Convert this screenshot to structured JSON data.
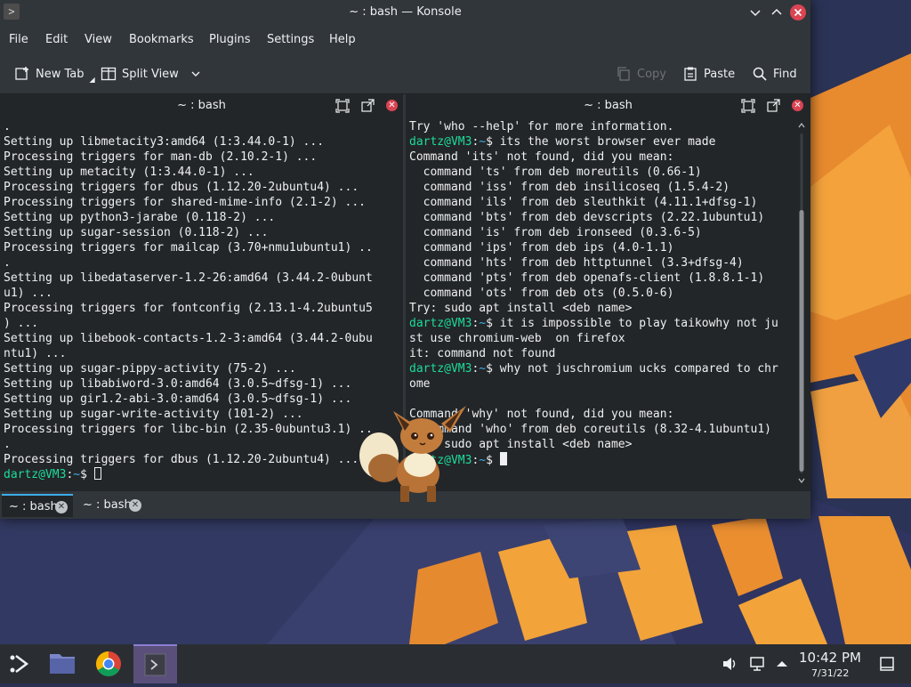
{
  "window": {
    "title": "~ : bash — Konsole",
    "app_icon": "terminal-icon"
  },
  "menu": [
    "File",
    "Edit",
    "View",
    "Bookmarks",
    "Plugins",
    "Settings",
    "Help"
  ],
  "toolbar": {
    "new_tab": "New Tab",
    "split_view": "Split View",
    "copy": "Copy",
    "paste": "Paste",
    "find": "Find"
  },
  "panes": {
    "left": {
      "title": "~ : bash",
      "lines": [
        ".",
        "Setting up libmetacity3:amd64 (1:3.44.0-1) ...",
        "Processing triggers for man-db (2.10.2-1) ...",
        "Setting up metacity (1:3.44.0-1) ...",
        "Processing triggers for dbus (1.12.20-2ubuntu4) ...",
        "Processing triggers for shared-mime-info (2.1-2) ...",
        "Setting up python3-jarabe (0.118-2) ...",
        "Setting up sugar-session (0.118-2) ...",
        "Processing triggers for mailcap (3.70+nmu1ubuntu1) ..",
        ".",
        "Setting up libedataserver-1.2-26:amd64 (3.44.2-0ubunt",
        "u1) ...",
        "Processing triggers for fontconfig (2.13.1-4.2ubuntu5",
        ") ...",
        "Setting up libebook-contacts-1.2-3:amd64 (3.44.2-0ubu",
        "ntu1) ...",
        "Setting up sugar-pippy-activity (75-2) ...",
        "Setting up libabiword-3.0:amd64 (3.0.5~dfsg-1) ...",
        "Setting up gir1.2-abi-3.0:amd64 (3.0.5~dfsg-1) ...",
        "Setting up sugar-write-activity (101-2) ...",
        "Processing triggers for libc-bin (2.35-0ubuntu3.1) ..",
        ".",
        "Processing triggers for dbus (1.12.20-2ubuntu4) ..."
      ],
      "prompt_user": "dartz@VM3",
      "prompt_path": "~",
      "prompt_symbol": "$ "
    },
    "right": {
      "title": "~ : bash",
      "lines": [
        {
          "t": "Try 'who --help' for more information."
        },
        {
          "p": true,
          "t": "its the worst browser ever made"
        },
        {
          "t": "Command 'its' not found, did you mean:"
        },
        {
          "t": "  command 'ts' from deb moreutils (0.66-1)"
        },
        {
          "t": "  command 'iss' from deb insilicoseq (1.5.4-2)"
        },
        {
          "t": "  command 'ils' from deb sleuthkit (4.11.1+dfsg-1)"
        },
        {
          "t": "  command 'bts' from deb devscripts (2.22.1ubuntu1)"
        },
        {
          "t": "  command 'is' from deb ironseed (0.3.6-5)"
        },
        {
          "t": "  command 'ips' from deb ips (4.0-1.1)"
        },
        {
          "t": "  command 'hts' from deb httptunnel (3.3+dfsg-4)"
        },
        {
          "t": "  command 'pts' from deb openafs-client (1.8.8.1-1)"
        },
        {
          "t": "  command 'ots' from deb ots (0.5.0-6)"
        },
        {
          "t": "Try: sudo apt install <deb name>"
        },
        {
          "p": true,
          "t": "it is impossible to play taikowhy not ju"
        },
        {
          "t": "st use chromium-web  on firefox"
        },
        {
          "t": "it: command not found"
        },
        {
          "p": true,
          "t": "why not juschromium ucks compared to chr"
        },
        {
          "t": "ome"
        },
        {
          "t": ""
        },
        {
          "t": "Command 'why' not found, did you mean:"
        },
        {
          "t": "  command 'who' from deb coreutils (8.32-4.1ubuntu1)"
        },
        {
          "t": "Try: sudo apt install <deb name>"
        },
        {
          "p": true,
          "t": ""
        }
      ],
      "prompt_user": "dartz@VM3",
      "prompt_path": "~",
      "prompt_symbol": "$ "
    }
  },
  "tabs": [
    {
      "label": "~ : bash",
      "active": true
    },
    {
      "label": "~ : bash",
      "active": false
    }
  ],
  "taskbar": {
    "clock_time": "10:42 PM",
    "clock_date": "7/31/22"
  },
  "colors": {
    "prompt_green": "#1cdc9a",
    "path_blue": "#3daee9",
    "close_red": "#da4453",
    "wallpaper_orange": "#f2a33a"
  }
}
